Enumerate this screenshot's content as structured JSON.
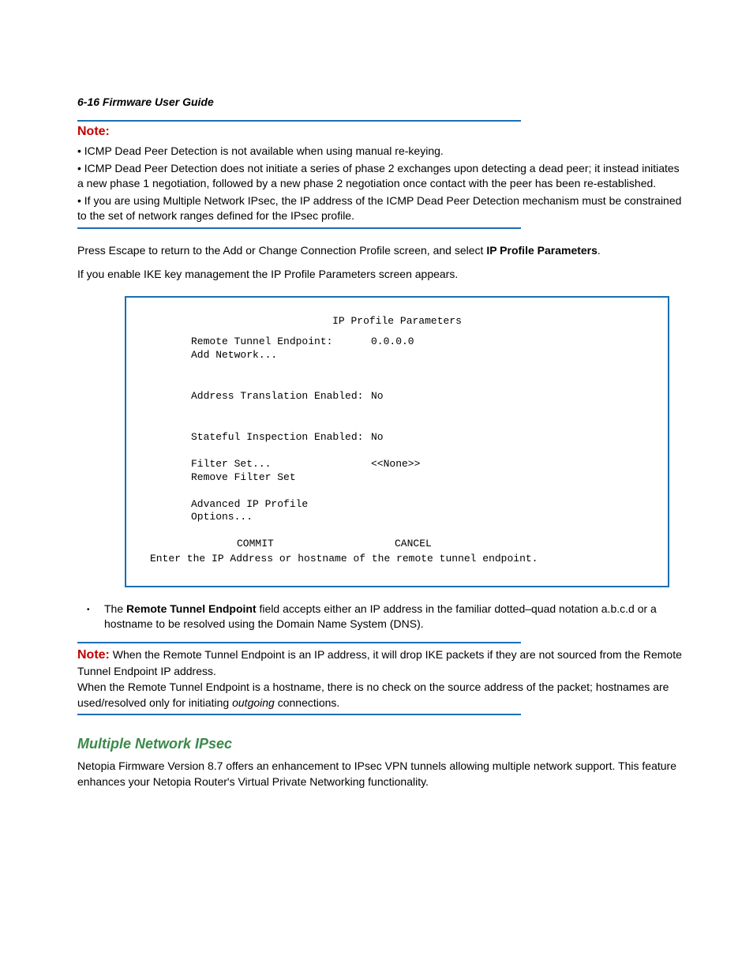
{
  "header": {
    "page_label": "6-16  Firmware User Guide"
  },
  "note1": {
    "label": "Note:",
    "bullet1": "• ICMP Dead Peer Detection is not available when using manual re-keying.",
    "bullet2": "• ICMP Dead Peer Detection does not initiate a series of phase 2 exchanges upon detecting a dead peer; it instead initiates a new phase 1 negotiation, followed by a new phase 2 negotiation once contact with the peer has been re-established.",
    "bullet3": "• If you are using Multiple Network IPsec, the IP address of the ICMP Dead Peer Detection mechanism must be constrained to the set of network ranges defined for the IPsec profile."
  },
  "body1": {
    "p1_pre": "Press Escape to return to the Add or Change Connection Profile screen, and select ",
    "p1_bold": "IP Profile Parameters",
    "p1_post": ".",
    "p2": "If you enable IKE key management the IP Profile Parameters screen appears."
  },
  "terminal": {
    "title": "IP Profile Parameters",
    "rows": {
      "remote_label": "Remote Tunnel Endpoint:",
      "remote_val": "0.0.0.0",
      "add_network": "Add Network...",
      "addr_trans_label": "Address Translation Enabled:",
      "addr_trans_val": "No",
      "stateful_label": "Stateful Inspection Enabled:",
      "stateful_val": "No",
      "filter_label": "Filter Set...",
      "filter_val": "<<None>>",
      "remove_filter": "Remove Filter Set",
      "advanced": "Advanced IP Profile Options..."
    },
    "actions": {
      "commit": "COMMIT",
      "cancel": "CANCEL"
    },
    "footer": "Enter the IP Address or hostname of the remote tunnel endpoint."
  },
  "bullet_after": {
    "pre": "The ",
    "bold": "Remote Tunnel Endpoint",
    "post": " field accepts either an IP address in the familiar dotted–quad notation a.b.c.d or a hostname to be resolved using the Domain Name System (DNS)."
  },
  "note2": {
    "label": "Note:",
    "line1": "When the Remote Tunnel Endpoint is an IP address, it will drop IKE packets if they are not sourced from the Remote Tunnel Endpoint IP address.",
    "line2_pre": "When the Remote Tunnel Endpoint is a hostname, there is no check on the source address of the packet; hostnames are used/resolved only for initiating ",
    "line2_italic": "outgoing",
    "line2_post": " connections."
  },
  "section": {
    "heading": "Multiple Network IPsec",
    "body": "Netopia Firmware Version 8.7 offers an enhancement to IPsec VPN tunnels allowing multiple network support. This feature enhances your Netopia Router's Virtual Private Networking functionality."
  }
}
